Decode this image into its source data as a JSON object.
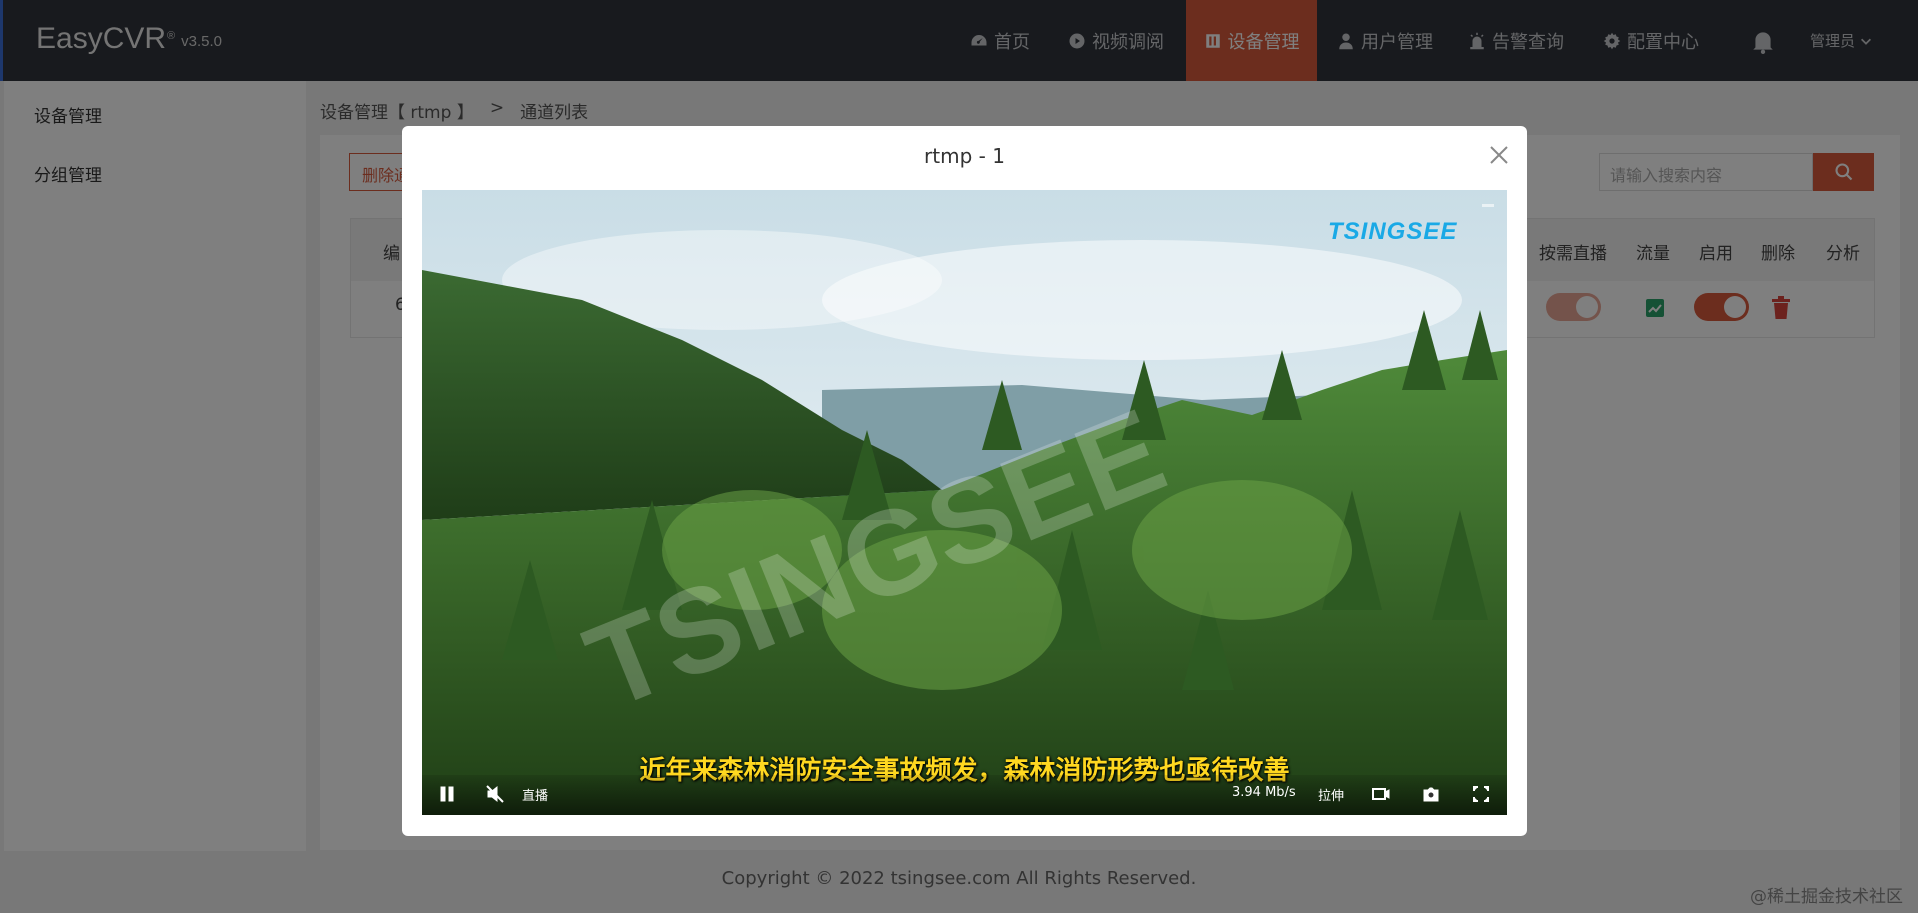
{
  "app": {
    "brand": "EasyCVR",
    "registered_mark": "®",
    "version": "v3.5.0"
  },
  "nav": {
    "items": [
      {
        "label": "首页",
        "icon": "dashboard-icon"
      },
      {
        "label": "视频调阅",
        "icon": "play-icon"
      },
      {
        "label": "设备管理",
        "icon": "device-icon",
        "active": true
      },
      {
        "label": "用户管理",
        "icon": "user-icon"
      },
      {
        "label": "告警查询",
        "icon": "alarm-icon"
      },
      {
        "label": "配置中心",
        "icon": "gear-icon"
      }
    ],
    "user_label": "管理员",
    "accent_color": "#d95a3c"
  },
  "sidebar": {
    "items": [
      {
        "label": "设备管理"
      },
      {
        "label": "分组管理"
      }
    ]
  },
  "breadcrumb": {
    "path": "设备管理【 rtmp 】",
    "separator": ">",
    "current": "通道列表"
  },
  "toolbar": {
    "delete_label": "删除通",
    "search_placeholder": "请输入搜索内容"
  },
  "table": {
    "headers": [
      "编",
      "按需直播",
      "流量",
      "启用",
      "删除",
      "分析"
    ],
    "first_cell": "6"
  },
  "modal": {
    "title": "rtmp - 1",
    "player": {
      "logo": "TSINGSEE",
      "subtitle": "近年来森林消防安全事故频发，森林消防形势也亟待改善",
      "live_label": "直播",
      "bitrate": "3.94 Mb/s",
      "stretch_label": "拉伸"
    }
  },
  "footer": {
    "copyright": "Copyright © 2022 tsingsee.com All Rights Reserved.",
    "corner": "@稀土掘金技术社区"
  }
}
